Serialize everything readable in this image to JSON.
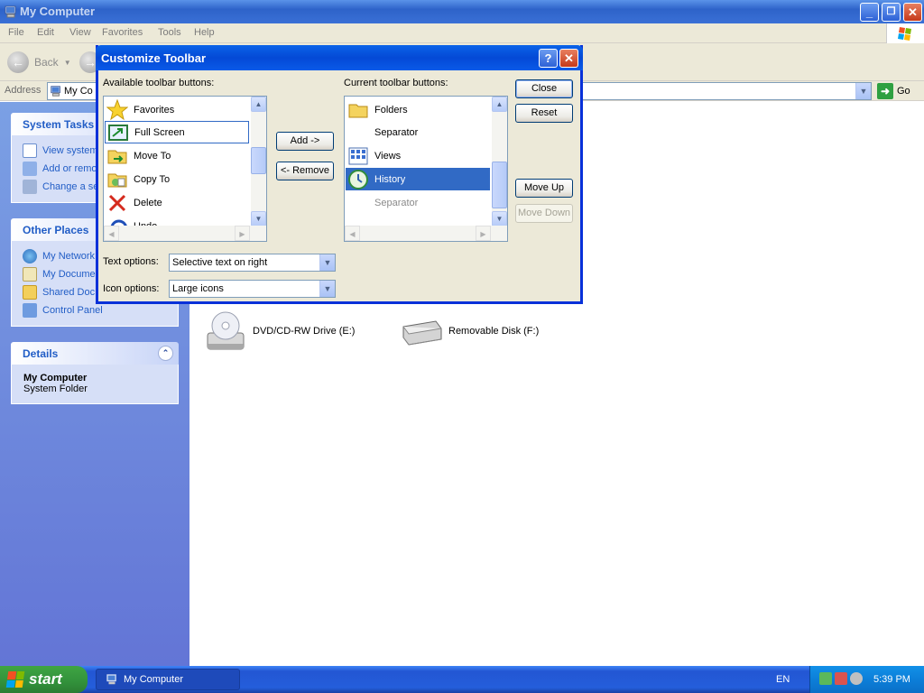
{
  "window": {
    "title": "My Computer",
    "minimize": "_",
    "restore": "❐",
    "close": "✕"
  },
  "menu": [
    "File",
    "Edit",
    "View",
    "Favorites",
    "Tools",
    "Help"
  ],
  "toolbar": {
    "back_label": "Back"
  },
  "address": {
    "label": "Address",
    "value": "My Co",
    "go_label": "Go"
  },
  "left_pane": {
    "system_tasks": {
      "title": "System Tasks",
      "items": [
        "View system",
        "Add or remo",
        "Change a se"
      ]
    },
    "other_places": {
      "title": "Other Places",
      "items": [
        "My Network",
        "My Docume",
        "Shared Doc",
        "Control Panel"
      ]
    },
    "details": {
      "title": "Details",
      "name": "My Computer",
      "type": "System Folder"
    }
  },
  "content": {
    "drives": [
      {
        "label": "DVD/CD-RW Drive (E:)",
        "icon": "cd-drive-icon"
      },
      {
        "label": "Removable Disk (F:)",
        "icon": "removable-disk-icon"
      }
    ]
  },
  "dialog": {
    "title": "Customize Toolbar",
    "help": "?",
    "close": "✕",
    "available_label": "Available toolbar buttons:",
    "available": [
      {
        "label": "Favorites",
        "icon": "star-icon",
        "state": "normal"
      },
      {
        "label": "Full Screen",
        "icon": "fullscreen-icon",
        "state": "focused"
      },
      {
        "label": "Move To",
        "icon": "move-to-icon",
        "state": "normal"
      },
      {
        "label": "Copy To",
        "icon": "copy-to-icon",
        "state": "normal"
      },
      {
        "label": "Delete",
        "icon": "delete-icon",
        "state": "normal"
      },
      {
        "label": "Undo",
        "icon": "undo-icon",
        "state": "normal"
      }
    ],
    "current_label": "Current toolbar buttons:",
    "current": [
      {
        "label": "Folders",
        "icon": "folder-icon",
        "state": "normal"
      },
      {
        "label": "Separator",
        "icon": "",
        "state": "normal"
      },
      {
        "label": "Views",
        "icon": "views-icon",
        "state": "normal"
      },
      {
        "label": "History",
        "icon": "history-icon",
        "state": "selected"
      },
      {
        "label": "Separator",
        "icon": "",
        "state": "gray"
      }
    ],
    "buttons": {
      "add": "Add ->",
      "remove": "<- Remove",
      "close": "Close",
      "reset": "Reset",
      "move_up": "Move Up",
      "move_down": "Move Down"
    },
    "text_options": {
      "label": "Text options:",
      "value": "Selective text on right"
    },
    "icon_options": {
      "label": "Icon options:",
      "value": "Large icons"
    }
  },
  "taskbar": {
    "start": "start",
    "task": "My Computer",
    "lang": "EN",
    "clock": "5:39 PM"
  },
  "colors": {
    "title_blue": "#0a5ae8",
    "selection": "#316ac5",
    "link_blue": "#215dc6",
    "start_green": "#32913b"
  }
}
